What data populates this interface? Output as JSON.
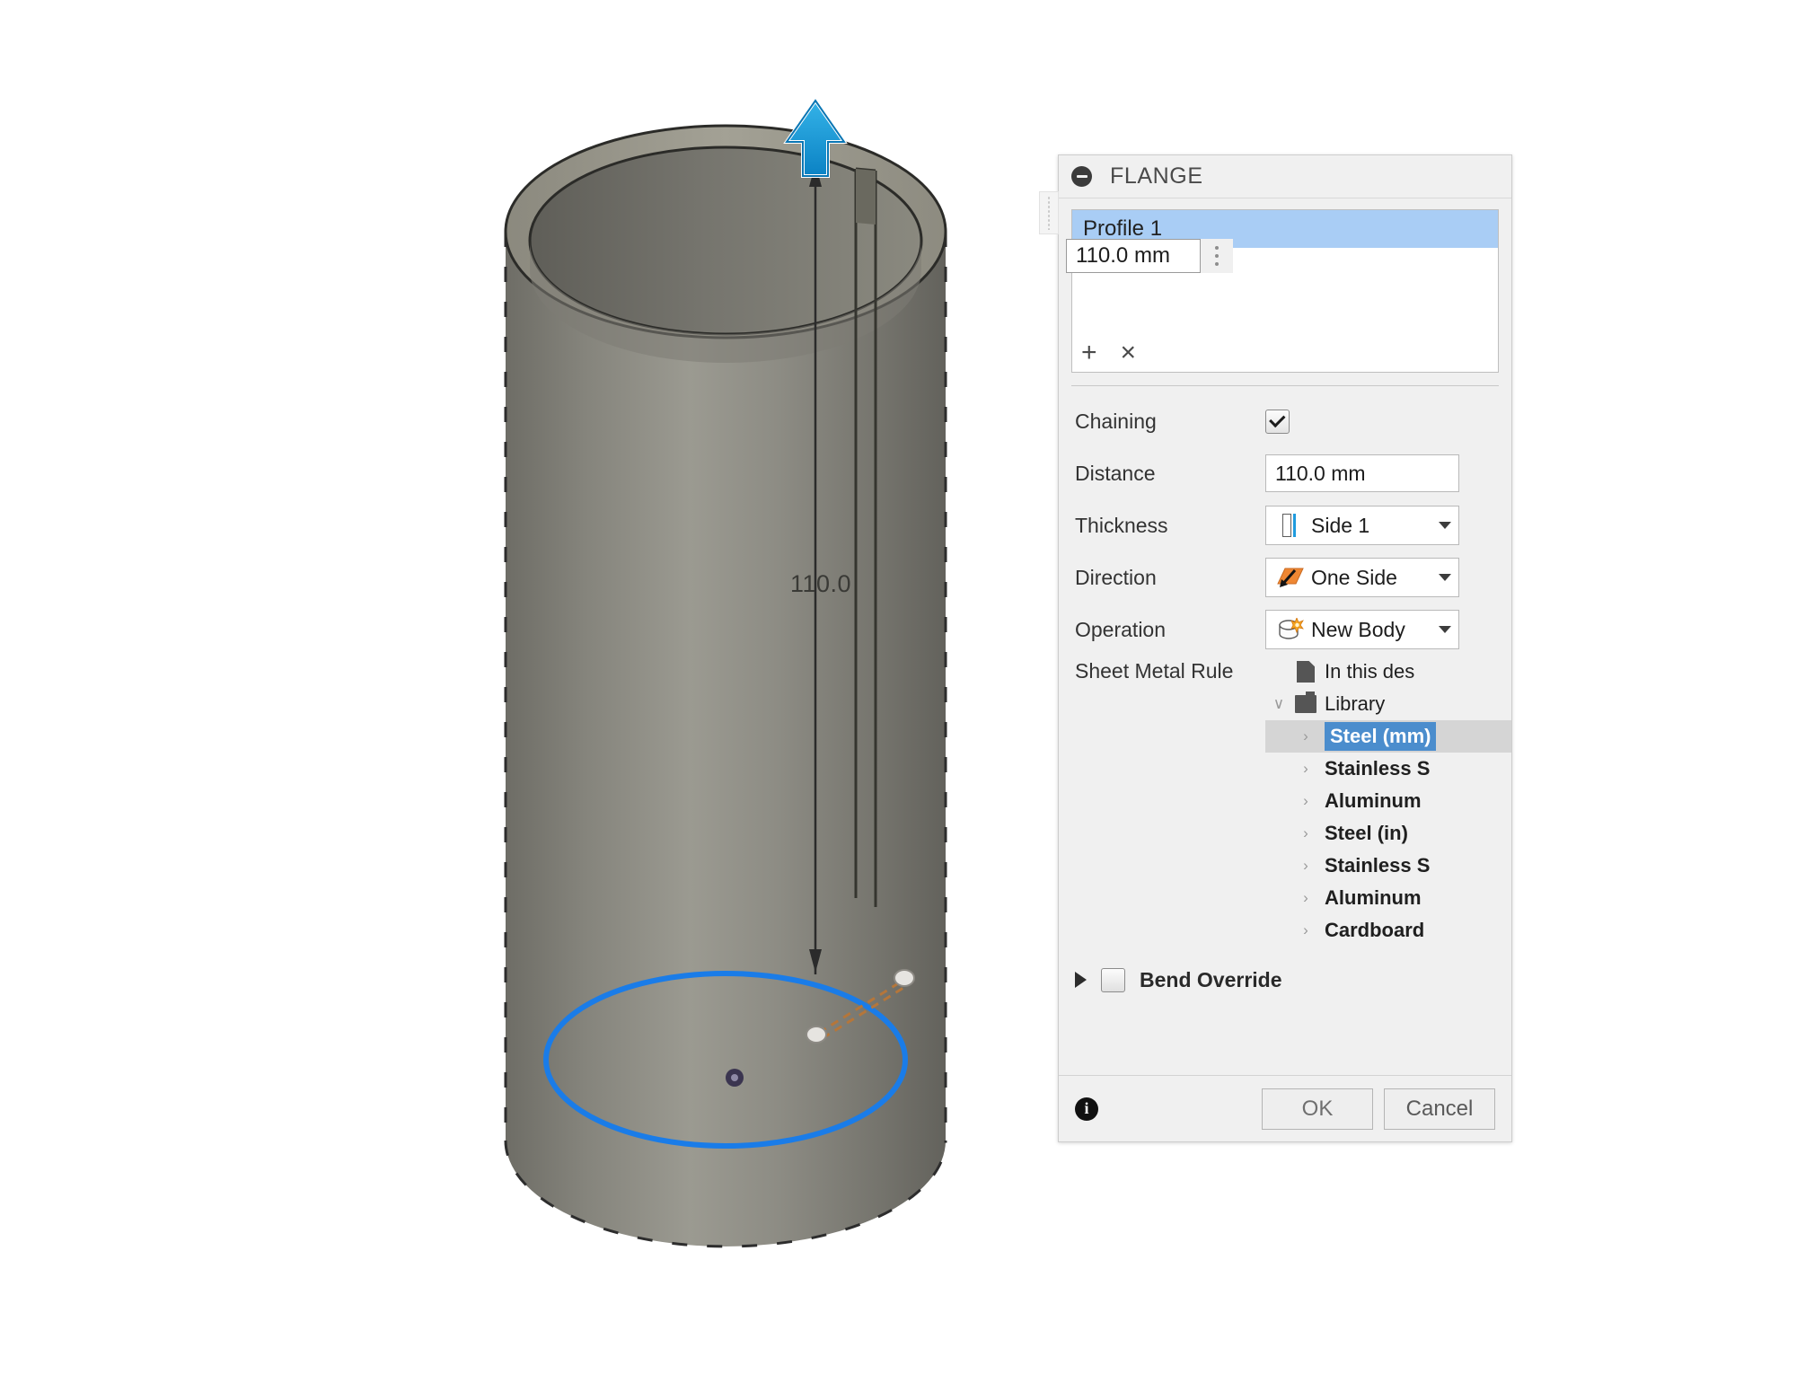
{
  "viewport": {
    "dimension_label": "110.0",
    "body_color": "#7b7a72",
    "selection_color": "#1a7ce8",
    "manipulator_arrow_color": "#1b9ad6",
    "origin_marker_color": "#3b3550",
    "construction_line_color": "#b5763a"
  },
  "dialog": {
    "title": "FLANGE",
    "collapse_icon": "minus-circle-icon",
    "profile": {
      "selected_item": "Profile 1",
      "editor_value": "110.0 mm",
      "add_glyph": "+",
      "remove_glyph": "×"
    },
    "fields": {
      "chaining": {
        "label": "Chaining",
        "checked": true
      },
      "distance": {
        "label": "Distance",
        "value": "110.0 mm"
      },
      "thickness": {
        "label": "Thickness",
        "value": "Side 1",
        "icon": "sheet-side-icon"
      },
      "direction": {
        "label": "Direction",
        "value": "One Side",
        "icon": "one-side-icon"
      },
      "operation": {
        "label": "Operation",
        "value": "New Body",
        "icon": "new-body-icon"
      }
    },
    "sheet_metal_rule": {
      "label": "Sheet Metal Rule",
      "nodes": [
        {
          "label": "In this des",
          "icon": "document-icon",
          "level": 0,
          "twist": "",
          "bold": false,
          "selected": false
        },
        {
          "label": "Library",
          "icon": "folder-icon",
          "level": 0,
          "twist": "∨",
          "bold": false,
          "selected": false
        },
        {
          "label": "Steel (mm)",
          "icon": "",
          "level": 1,
          "twist": "›",
          "bold": true,
          "selected": true
        },
        {
          "label": "Stainless S",
          "icon": "",
          "level": 1,
          "twist": "›",
          "bold": true,
          "selected": false
        },
        {
          "label": "Aluminum",
          "icon": "",
          "level": 1,
          "twist": "›",
          "bold": true,
          "selected": false
        },
        {
          "label": "Steel (in)",
          "icon": "",
          "level": 1,
          "twist": "›",
          "bold": true,
          "selected": false
        },
        {
          "label": "Stainless S",
          "icon": "",
          "level": 1,
          "twist": "›",
          "bold": true,
          "selected": false
        },
        {
          "label": "Aluminum",
          "icon": "",
          "level": 1,
          "twist": "›",
          "bold": true,
          "selected": false
        },
        {
          "label": "Cardboard",
          "icon": "",
          "level": 1,
          "twist": "›",
          "bold": true,
          "selected": false
        }
      ]
    },
    "bend_override": {
      "label": "Bend Override",
      "checked": false,
      "expanded": false
    },
    "footer": {
      "info_glyph": "i",
      "ok_label": "OK",
      "cancel_label": "Cancel"
    }
  }
}
